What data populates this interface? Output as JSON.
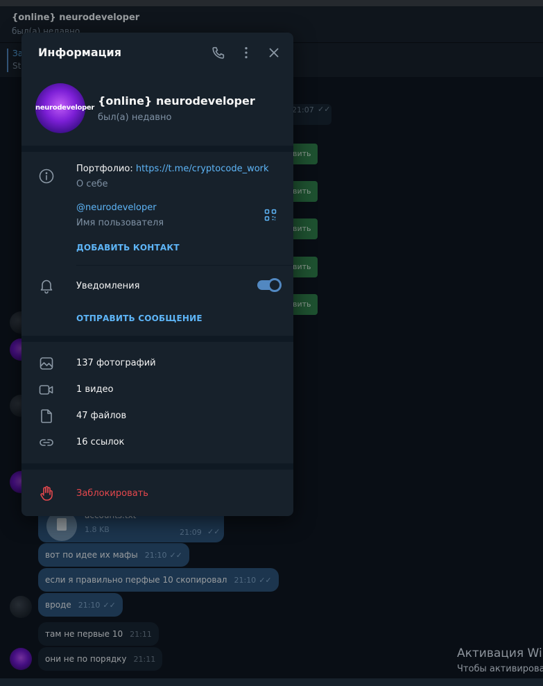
{
  "chat": {
    "title": "{online} neurodeveloper",
    "status": "был(а) недавно",
    "pinned_label": "За",
    "pinned_sub": "St",
    "card_time": "21:07",
    "green_buttons": [
      "вить",
      "вить",
      "вить",
      "вить",
      "вить"
    ],
    "file": {
      "name": "accounts.txt",
      "size": "1.8 KB",
      "time": "21:09"
    },
    "messages": [
      {
        "text": "вот по идее их мафы",
        "time": "21:10",
        "direction": "out"
      },
      {
        "text": "если я правильно перфые 10 скопировал",
        "time": "21:10",
        "direction": "out"
      },
      {
        "text": "вроде",
        "time": "21:10",
        "direction": "out"
      },
      {
        "text": "там не первые 10",
        "time": "21:11",
        "direction": "in"
      },
      {
        "text": "они не по порядку",
        "time": "21:11",
        "direction": "in"
      }
    ]
  },
  "windows_watermark": {
    "title": "Активация Wi",
    "subtitle": "Чтобы активирова"
  },
  "info_panel": {
    "title": "Информация",
    "header_icons": [
      "phone-icon",
      "more-vertical-icon",
      "close-icon"
    ],
    "profile": {
      "avatar_text": "neurodeveloper",
      "name": "{online} neurodeveloper",
      "status": "был(а) недавно"
    },
    "bio": {
      "label": "Портфолио: ",
      "link": "https://t.me/cryptocode_work",
      "caption": "О себе"
    },
    "username": {
      "value": "@neurodeveloper",
      "caption": "Имя пользователя"
    },
    "add_contact": "ДОБАВИТЬ КОНТАКТ",
    "notifications": {
      "label": "Уведомления",
      "enabled": true
    },
    "send_message": "ОТПРАВИТЬ СООБЩЕНИЕ",
    "media": [
      {
        "icon": "photo-icon",
        "label": "137 фотографий"
      },
      {
        "icon": "video-icon",
        "label": "1 видео"
      },
      {
        "icon": "file-icon",
        "label": "47 файлов"
      },
      {
        "icon": "link-icon",
        "label": "16 ссылок"
      }
    ],
    "block": "Заблокировать"
  },
  "colors": {
    "accent": "#5eb5f7",
    "danger": "#e5484d",
    "panel_bg": "#17212b",
    "chat_bg": "#0e1621",
    "outgoing_bubble": "#2b5278"
  }
}
